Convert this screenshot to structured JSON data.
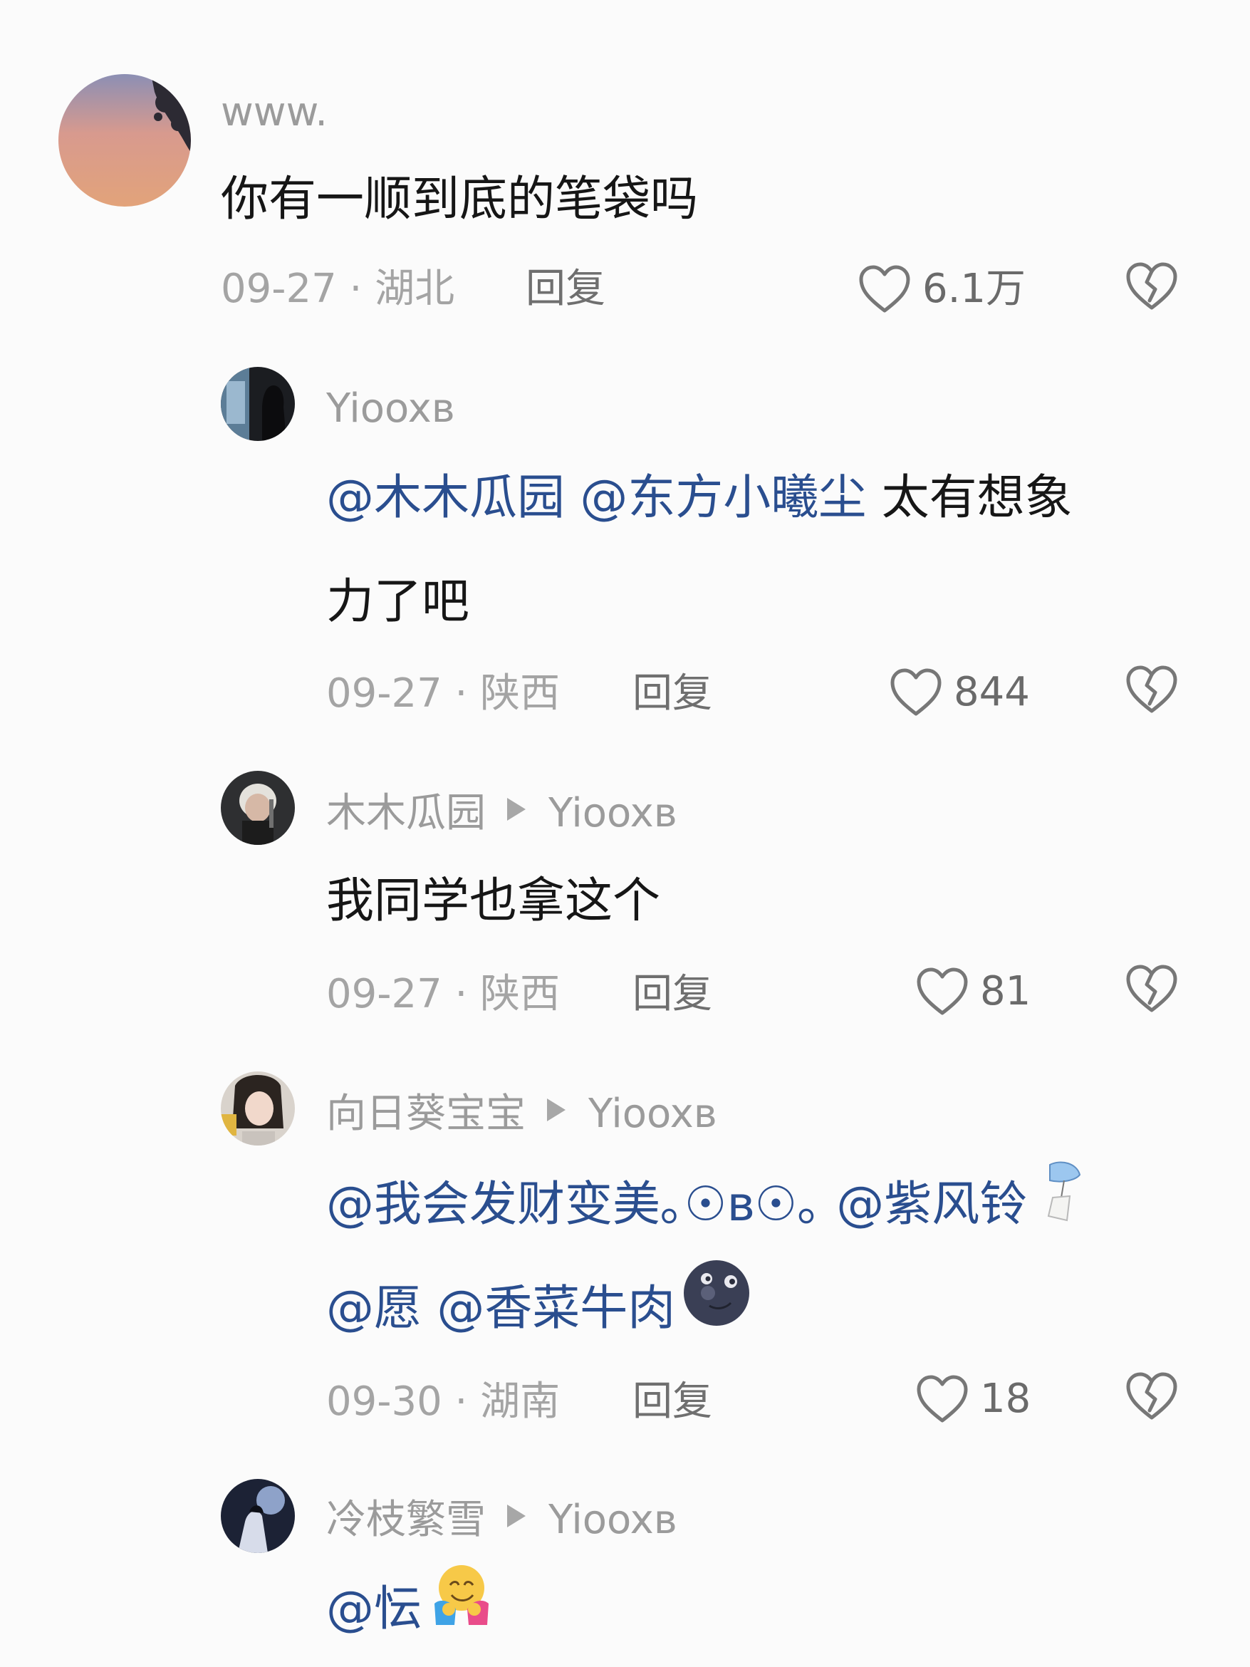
{
  "comments": [
    {
      "username": "www.",
      "text": "你有一顺到底的笔袋吗",
      "date": "09-27",
      "location": "湖北",
      "reply_label": "回复",
      "likes": "6.1万"
    },
    {
      "username": "Yiooxв",
      "mentions": [
        "@木木瓜园",
        "@东方小曦尘"
      ],
      "text_line1_suffix": "太有想象",
      "text_line2": "力了吧",
      "date": "09-27",
      "location": "陕西",
      "reply_label": "回复",
      "likes": "844"
    },
    {
      "username": "木木瓜园",
      "reply_to": "Yiooxв",
      "text": "我同学也拿这个",
      "date": "09-27",
      "location": "陕西",
      "reply_label": "回复",
      "likes": "81"
    },
    {
      "username": "向日葵宝宝",
      "reply_to": "Yiooxв",
      "mentions_line1": [
        "@我会发财变美｡☉ʙ☉｡",
        "@紫风铃"
      ],
      "mentions_line2": [
        "@愿",
        "@香菜牛肉"
      ],
      "date": "09-30",
      "location": "湖南",
      "reply_label": "回复",
      "likes": "18"
    },
    {
      "username": "冷枝繁雪",
      "reply_to": "Yiooxв",
      "mentions": [
        "@忶"
      ]
    }
  ],
  "meta_separator": " · ",
  "icons": {
    "like": "heart-outline-icon",
    "dislike": "broken-heart-icon",
    "reply_arrow": "triangle-right-icon"
  },
  "colors": {
    "mention": "#2a4e8f",
    "meta": "#a4a4a4",
    "username": "#9b9b9b"
  }
}
